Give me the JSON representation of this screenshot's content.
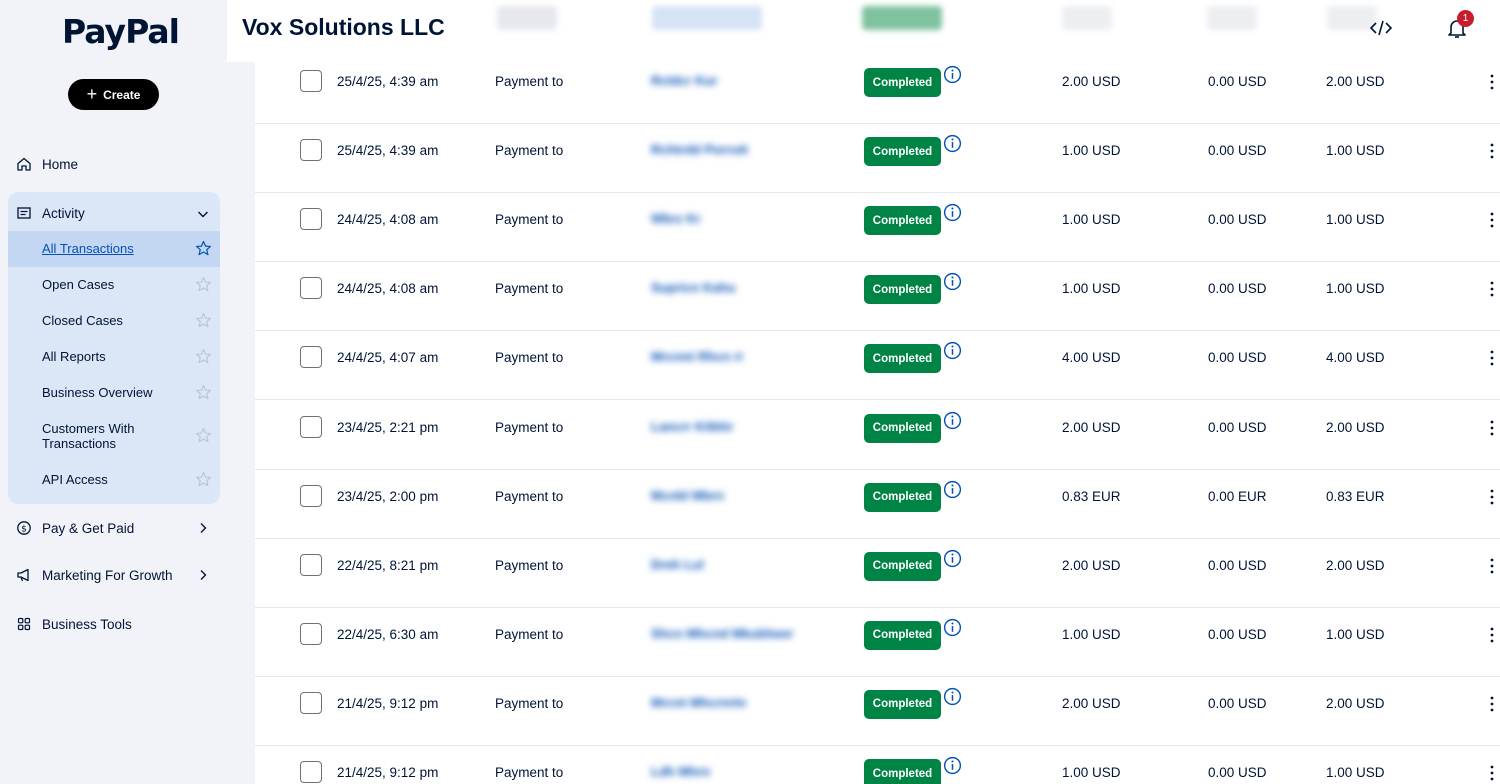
{
  "brand": {
    "logo_text": "PayPal"
  },
  "sidebar": {
    "create_label": "Create",
    "home": "Home",
    "activity": "Activity",
    "activity_items": [
      {
        "label": "All Transactions",
        "selected": true
      },
      {
        "label": "Open Cases"
      },
      {
        "label": "Closed Cases"
      },
      {
        "label": "All Reports"
      },
      {
        "label": "Business Overview"
      },
      {
        "label": "Customers With Transactions"
      },
      {
        "label": "API Access"
      }
    ],
    "pay_get_paid": "Pay & Get Paid",
    "marketing": "Marketing For Growth",
    "business_tools": "Business Tools"
  },
  "header": {
    "company": "Vox Solutions LLC",
    "notification_count": "1",
    "icons": [
      "code-icon",
      "bell-icon"
    ]
  },
  "transactions": [
    {
      "date": "25/4/25, 4:39 am",
      "type": "Payment to",
      "name": "Rcldcr Kur",
      "status": "Completed",
      "gross": "2.00 USD",
      "fee": "0.00 USD",
      "net": "2.00 USD"
    },
    {
      "date": "25/4/25, 4:39 am",
      "type": "Payment to",
      "name": "Rchtrdd Porrutt",
      "status": "Completed",
      "gross": "1.00 USD",
      "fee": "0.00 USD",
      "net": "1.00 USD"
    },
    {
      "date": "24/4/25, 4:08 am",
      "type": "Payment to",
      "name": "Wbrz Kr",
      "status": "Completed",
      "gross": "1.00 USD",
      "fee": "0.00 USD",
      "net": "1.00 USD"
    },
    {
      "date": "24/4/25, 4:08 am",
      "type": "Payment to",
      "name": "Supricn Kahu",
      "status": "Completed",
      "gross": "1.00 USD",
      "fee": "0.00 USD",
      "net": "1.00 USD"
    },
    {
      "date": "24/4/25, 4:07 am",
      "type": "Payment to",
      "name": "Mrcnnt Rhcn ri",
      "status": "Completed",
      "gross": "4.00 USD",
      "fee": "0.00 USD",
      "net": "4.00 USD"
    },
    {
      "date": "23/4/25, 2:21 pm",
      "type": "Payment to",
      "name": "Lancrr Kitbhr",
      "status": "Completed",
      "gross": "2.00 USD",
      "fee": "0.00 USD",
      "net": "2.00 USD"
    },
    {
      "date": "23/4/25, 2:00 pm",
      "type": "Payment to",
      "name": "Mcnbl Mbrn",
      "status": "Completed",
      "gross": "0.83 EUR",
      "fee": "0.00 EUR",
      "net": "0.83 EUR"
    },
    {
      "date": "22/4/25, 8:21 pm",
      "type": "Payment to",
      "name": "Dreh Lul",
      "status": "Completed",
      "gross": "2.00 USD",
      "fee": "0.00 USD",
      "net": "2.00 USD"
    },
    {
      "date": "22/4/25, 6:30 am",
      "type": "Payment to",
      "name": "Shcn Mhcnd Mkubheer",
      "status": "Completed",
      "gross": "1.00 USD",
      "fee": "0.00 USD",
      "net": "1.00 USD"
    },
    {
      "date": "21/4/25, 9:12 pm",
      "type": "Payment to",
      "name": "Mrcnt Mhcrnrtn",
      "status": "Completed",
      "gross": "2.00 USD",
      "fee": "0.00 USD",
      "net": "2.00 USD"
    },
    {
      "date": "21/4/25, 9:12 pm",
      "type": "Payment to",
      "name": "Ldh Mhrn",
      "status": "Completed",
      "gross": "1.00 USD",
      "fee": "0.00 USD",
      "net": "1.00 USD"
    }
  ]
}
